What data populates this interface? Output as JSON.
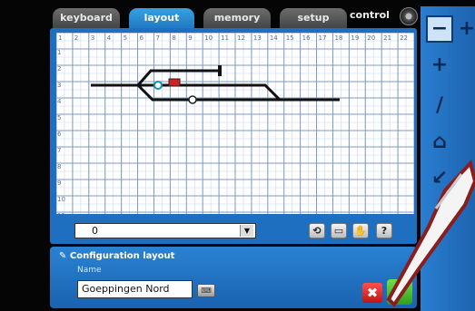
{
  "tabs": [
    {
      "label": "keyboard",
      "active": false
    },
    {
      "label": "layout",
      "active": true
    },
    {
      "label": "memory",
      "active": false
    },
    {
      "label": "setup",
      "active": false
    }
  ],
  "control_label": "control",
  "grid": {
    "columns": [
      "1",
      "2",
      "3",
      "4",
      "5",
      "6",
      "7",
      "8",
      "9",
      "10",
      "11",
      "12",
      "13",
      "14",
      "15",
      "16",
      "17",
      "18",
      "19",
      "20",
      "21",
      "22"
    ],
    "rows": [
      "1",
      "2",
      "3",
      "4",
      "5",
      "6",
      "7",
      "8",
      "9",
      "10",
      "11"
    ]
  },
  "bottom_bar": {
    "select_value": "0",
    "tool_buttons": [
      "rotate-icon",
      "edit-icon",
      "grab-icon",
      "?"
    ]
  },
  "config": {
    "title": "Configuration layout",
    "name_label": "Name",
    "name_value": "Goeppingen Nord",
    "keyboard_button": "⌨",
    "cancel_symbol": "✖",
    "ok_symbol": "✔"
  },
  "tool_strip": {
    "tools": [
      "−",
      "+",
      "+",
      "/",
      "⌂",
      "↙"
    ]
  },
  "colors": {
    "panel_blue": "#1e6fbf",
    "tab_active": "#2a8ad6",
    "ok_green": "#3fb22a",
    "cancel_red": "#e02020",
    "track": "#111111"
  }
}
